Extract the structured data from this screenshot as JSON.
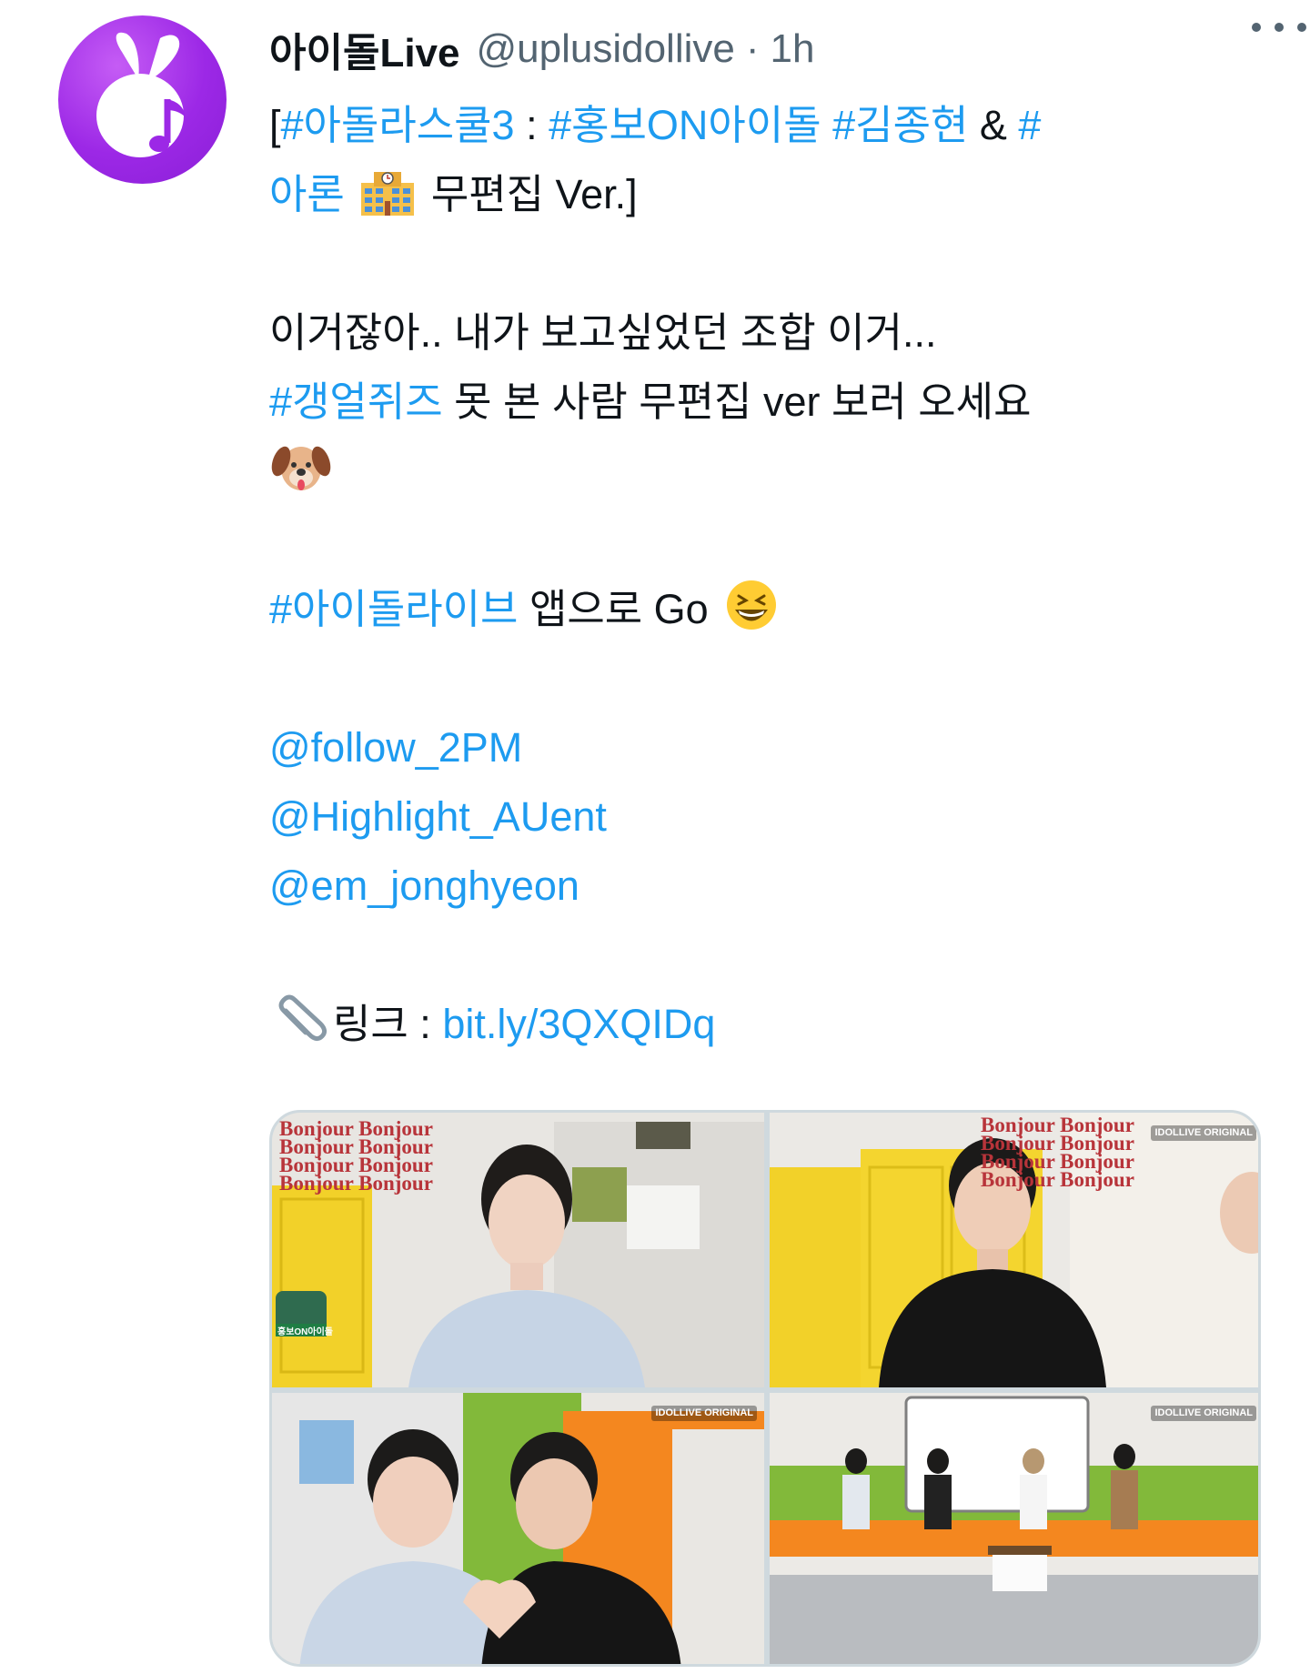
{
  "author": {
    "display_name": "아이돌Live",
    "handle": "@uplusidollive",
    "separator": "·",
    "time": "1h",
    "avatar_icon": "music-note-rabbit-icon",
    "avatar_color": "#9c28e6"
  },
  "more_icon": "more-horizontal-icon",
  "colors": {
    "link": "#1d9bf0",
    "text": "#0f1419",
    "muted": "#536471"
  },
  "tweet": {
    "l1_open": "[",
    "l1_tag1": "#아돌라스쿨3",
    "l1_colon": " : ",
    "l1_tag2": "#홍보ON아이돌",
    "l1_space": " ",
    "l1_tag3": "#김종현",
    "l1_amp": " & ",
    "l1_hash": "#",
    "l2_tag_cont": "아론",
    "l2_emoji": "school-emoji",
    "l2_text": " 무편집 Ver.]",
    "l3_text": "이거잖아.. 내가 보고싶었던 조합 이거...",
    "l4_tag": "#갱얼쥐즈",
    "l4_text": " 못 본 사람 무편집 ver 보러 오세요",
    "l5_emoji": "dog-face-emoji",
    "l6_tag": "#아이돌라이브",
    "l6_text": " 앱으로 Go ",
    "l6_emoji": "grinning-squinting-face-emoji",
    "mention1": "@follow_2PM",
    "mention2": "@Highlight_AUent",
    "mention3": "@em_jonghyeon",
    "link_emoji": "paperclip-emoji",
    "link_label": "링크 : ",
    "link_url": "bit.ly/3QXQIDq"
  },
  "media": {
    "images": [
      {
        "brand_text": "Bonjour Bonjour\nBonjour Bonjour\nBonjour Bonjour\nBonjour Bonjour",
        "badge": "홍보ON아이돌"
      },
      {
        "brand_text": "Bonjour Bonjour\nBonjour Bonjour\nBonjour Bonjour\nBonjour Bonjour",
        "badge": "IDOLLIVE ORIGINAL"
      },
      {
        "badge": "IDOLLIVE ORIGINAL"
      },
      {
        "badge": "IDOLLIVE ORIGINAL"
      }
    ]
  }
}
